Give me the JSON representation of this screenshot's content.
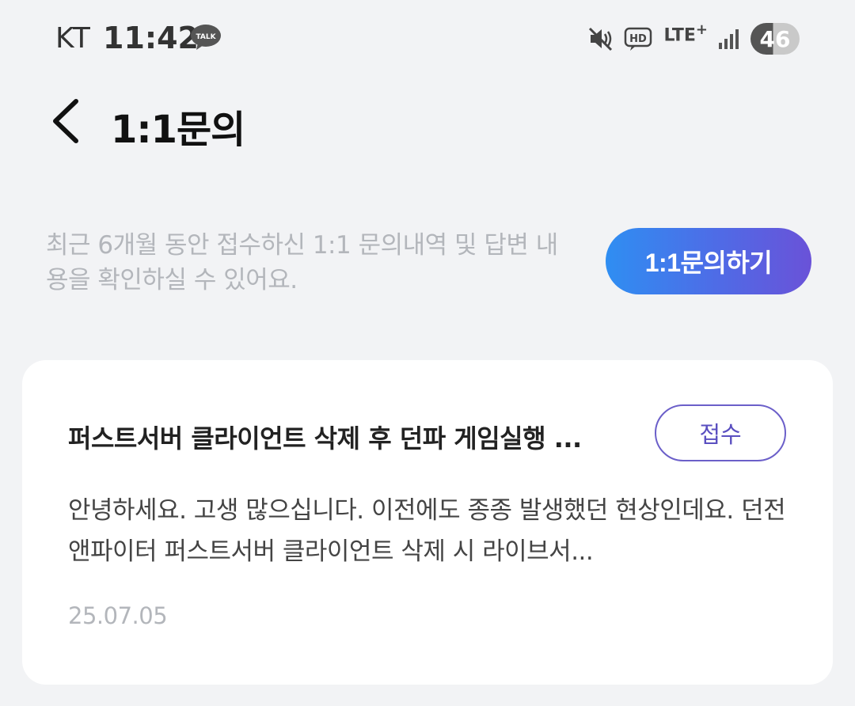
{
  "status_bar": {
    "carrier": "KT",
    "time": "11:42",
    "talk_badge": "TALK",
    "network": "LTE",
    "network_plus": "+",
    "hd_label": "HD",
    "battery": "46",
    "icons": [
      "talk-icon",
      "mute-icon",
      "hd-voice-icon",
      "lte-icon",
      "signal-icon",
      "battery-icon"
    ]
  },
  "header": {
    "title": "1:1문의",
    "back_icon": "chevron-left-icon"
  },
  "intro": {
    "text": "최근 6개월 동안 접수하신 1:1 문의내역 및 답변 내용을 확인하실 수 있어요.",
    "button_label": "1:1문의하기"
  },
  "inquiries": [
    {
      "title": "퍼스트서버 클라이언트 삭제 후 던파 게임실행 ...",
      "status": "접수",
      "body": "안녕하세요. 고생 많으십니다. 이전에도 종종 발생했던 현상인데요. 던전앤파이터 퍼스트서버 클라이언트 삭제 시 라이브서...",
      "date": "25.07.05"
    }
  ],
  "colors": {
    "background": "#f2f3f5",
    "accent_start": "#2f8ef2",
    "accent_end": "#6a52d8",
    "status_border": "#6b5fc9",
    "muted_text": "#b3b6bb"
  }
}
